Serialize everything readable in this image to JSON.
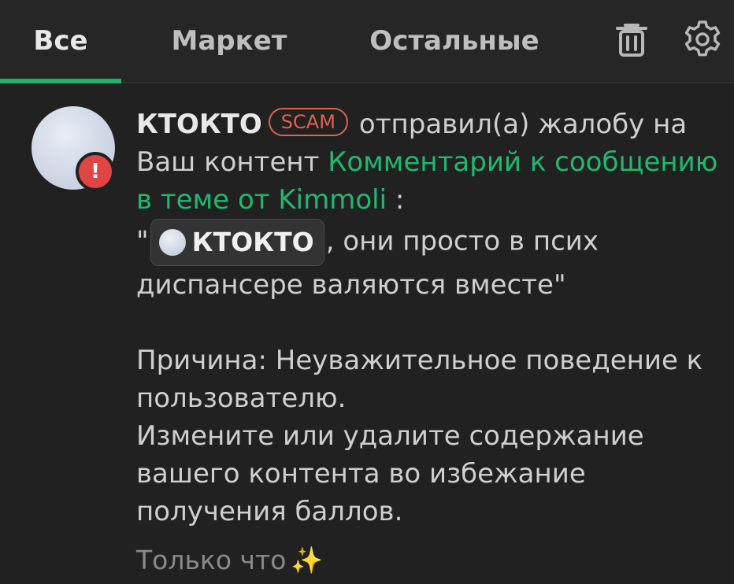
{
  "tabs": [
    {
      "label": "Все",
      "active": true
    },
    {
      "label": "Маркет",
      "active": false
    },
    {
      "label": "Остальные",
      "active": false
    }
  ],
  "toolbar": {
    "trash_icon": "trash-icon",
    "settings_icon": "gear-icon"
  },
  "colors": {
    "accent": "#1fb16a",
    "link": "#20b96f",
    "scam": "#e0614f",
    "alert": "#e04545",
    "background": "#212121"
  },
  "notification": {
    "username": "КТОКТО",
    "badge": "SCAM",
    "action": "отправил(а) жалобу на Ваш контент",
    "link_text": "Комментарий к сообщению в теме от Kimmoli",
    "colon": " :",
    "quote_open": "\"",
    "mention_name": "КТОКТО",
    "quote_rest": ", они просто в псих диспансере валяются вместе\"",
    "reason": "Причина: Неуважительное поведение к пользователю.",
    "instruction": "Измените или удалите содержание вашего контента во избежание получения баллов.",
    "time": "Только что",
    "alert_symbol": "!",
    "sparkle": "✨"
  }
}
